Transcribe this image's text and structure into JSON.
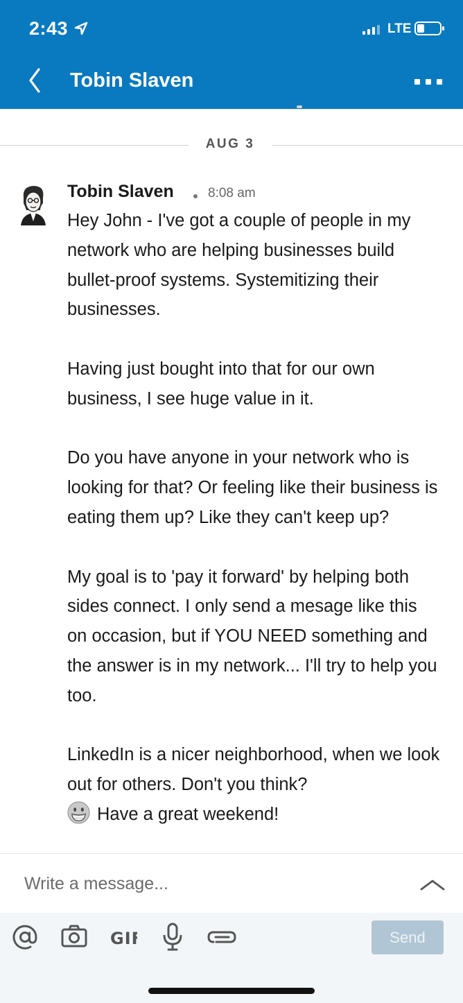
{
  "status_bar": {
    "time": "2:43",
    "network": "LTE"
  },
  "header": {
    "title": "Tobin Slaven"
  },
  "date_divider": "AUG 3",
  "message": {
    "sender": "Tobin Slaven",
    "time": "8:08 am",
    "paragraphs": [
      "Hey John - I've got a couple of people in my network who are helping businesses build bullet-proof systems. Systemitizing their businesses.",
      "Having just bought into that for our own business, I see huge value in it.",
      "Do you have anyone in your network who is looking for that? Or feeling like their business is eating them up? Like they can't keep up?",
      "My goal is to 'pay it forward' by helping both sides connect. I only send a mesage like this on occasion, but if YOU NEED something and the answer is in my network... I'll try to help you too.",
      "LinkedIn is a nicer neighborhood, when we look out for others. Don't you think?"
    ],
    "closing": "Have a great weekend!"
  },
  "composer": {
    "placeholder": "Write a message...",
    "gif_label": "GIF",
    "send_label": "Send"
  },
  "icons": {
    "back": "chevron-left-icon",
    "more": "more-horizontal-icon",
    "mention": "at-sign-icon",
    "camera": "camera-icon",
    "gif": "gif-icon",
    "mic": "microphone-icon",
    "attach": "paperclip-icon"
  },
  "colors": {
    "brand": "#0a7ac0",
    "send_disabled": "#b1c6d4",
    "toolbar_bg": "#f3f6f8"
  }
}
